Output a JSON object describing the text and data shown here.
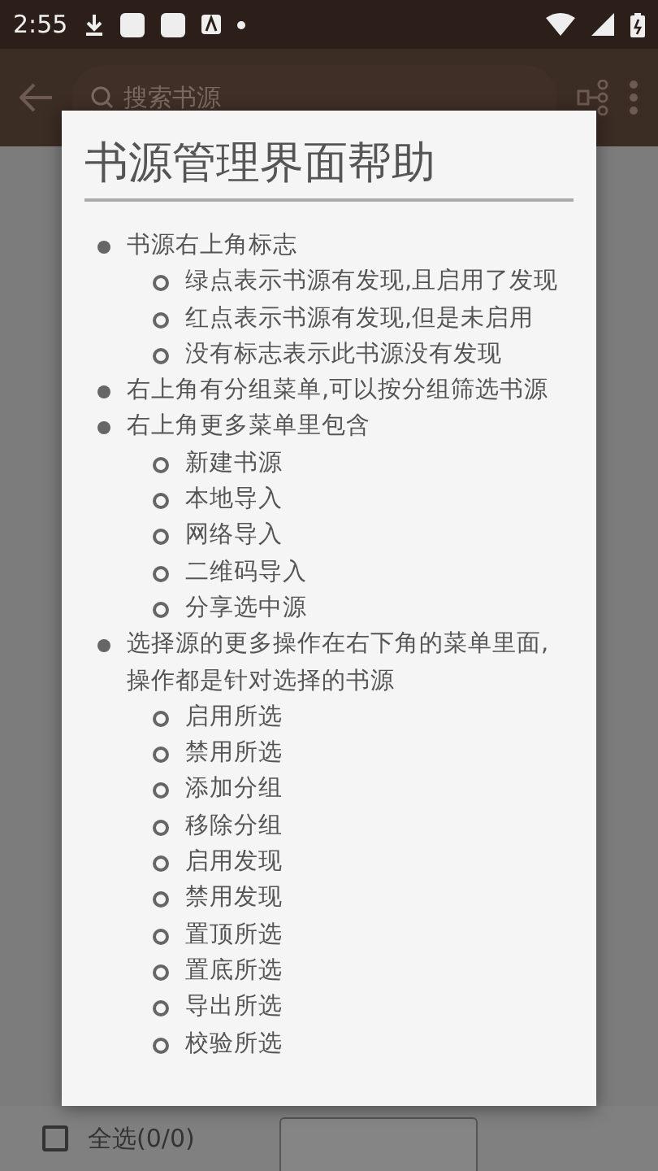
{
  "status_bar": {
    "time": "2:55"
  },
  "toolbar": {
    "search": {
      "placeholder": "搜索书源"
    }
  },
  "dialog": {
    "title": "书源管理界面帮助",
    "items": [
      {
        "text": "书源右上角标志",
        "children": [
          {
            "text": "绿点表示书源有发现,且启用了发现"
          },
          {
            "text": "红点表示书源有发现,但是未启用"
          },
          {
            "text": "没有标志表示此书源没有发现"
          }
        ]
      },
      {
        "text": "右上角有分组菜单,可以按分组筛选书源"
      },
      {
        "text": "右上角更多菜单里包含",
        "children": [
          {
            "text": "新建书源"
          },
          {
            "text": "本地导入"
          },
          {
            "text": "网络导入"
          },
          {
            "text": "二维码导入"
          },
          {
            "text": "分享选中源"
          }
        ]
      },
      {
        "text": "选择源的更多操作在右下角的菜单里面,操作都是针对选择的书源",
        "children": [
          {
            "text": "启用所选"
          },
          {
            "text": "禁用所选"
          },
          {
            "text": "添加分组"
          },
          {
            "text": "移除分组"
          },
          {
            "text": "启用发现"
          },
          {
            "text": "禁用发现"
          },
          {
            "text": "置顶所选"
          },
          {
            "text": "置底所选"
          },
          {
            "text": "导出所选"
          },
          {
            "text": "校验所选"
          }
        ]
      }
    ]
  },
  "bottom_bar": {
    "select_all": {
      "label": "全选(0/0)",
      "checked": false
    }
  }
}
